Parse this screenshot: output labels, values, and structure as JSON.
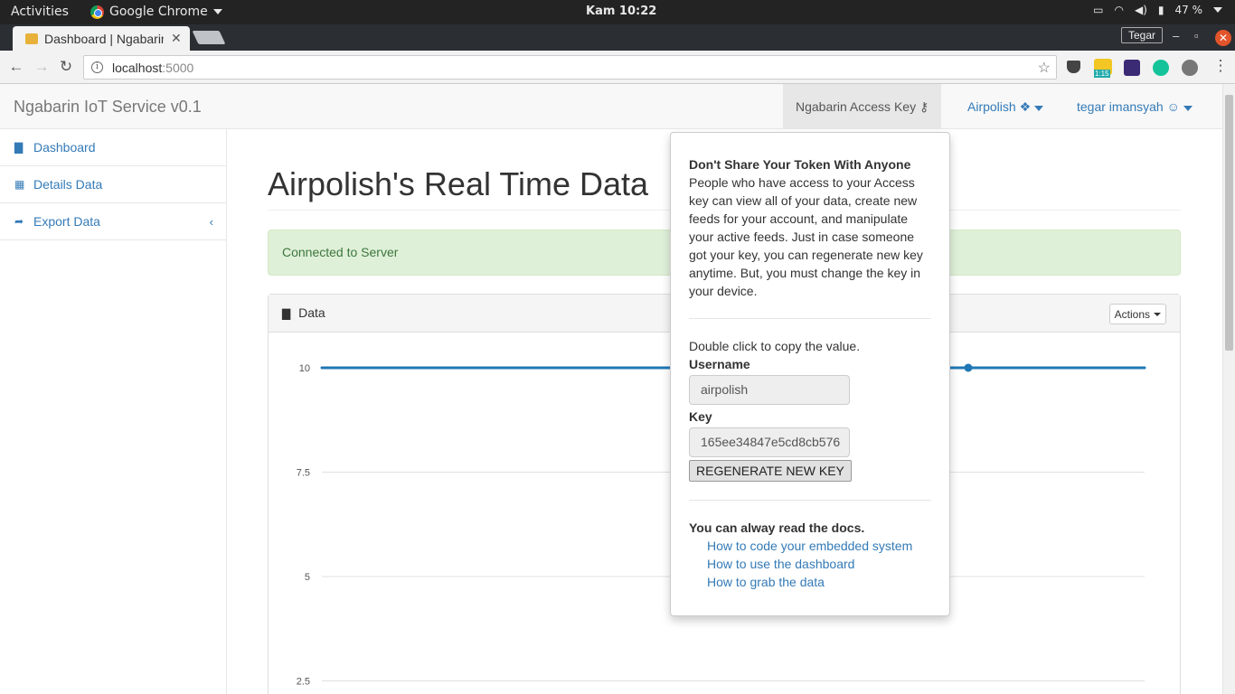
{
  "os": {
    "activities": "Activities",
    "app_menu": "Google Chrome",
    "clock": "Kam 10:22",
    "battery": "47 %"
  },
  "browser": {
    "tab_title": "Dashboard | Ngabarin",
    "profile": "Tegar",
    "url_host": "localhost",
    "url_port": ":5000",
    "extension_badge": "1:15"
  },
  "navbar": {
    "brand": "Ngabarin IoT Service v0.1",
    "access_key": "Ngabarin Access Key",
    "device": "Airpolish",
    "user": "tegar imansyah"
  },
  "sidebar": {
    "items": [
      {
        "label": "Dashboard",
        "icon": "bar-chart-icon"
      },
      {
        "label": "Details Data",
        "icon": "table-icon"
      },
      {
        "label": "Export Data",
        "icon": "share-icon"
      }
    ]
  },
  "main": {
    "title": "Airpolish's Real Time Data",
    "alert": "Connected to Server",
    "panel_title": "Data",
    "actions_label": "Actions"
  },
  "popover": {
    "warning_title": "Don't Share Your Token With Anyone",
    "warning_text": "People who have access to your Access key can view all of your data, create new feeds for your account, and manipulate your active feeds. Just in case someone got your key, you can regenerate new key anytime. But, you must change the key in your device.",
    "copy_hint": "Double click to copy the value.",
    "username_label": "Username",
    "username_value": "airpolish",
    "key_label": "Key",
    "key_value": "165ee34847e5cd8cb576",
    "regen_label": "REGENERATE NEW KEY",
    "docs_title": "You can alway read the docs.",
    "docs_links": [
      "How to code your embedded system",
      "How to use the dashboard",
      "How to grab the data"
    ]
  },
  "colors": {
    "link": "#337ab7",
    "series": "#1f77b4",
    "alert_bg": "#dff0d8"
  },
  "chart_data": {
    "type": "line",
    "y_ticks": [
      "10",
      "7.5",
      "5",
      "2.5"
    ],
    "ylim": [
      2.5,
      10
    ],
    "series": [
      {
        "values": [
          10,
          10,
          10,
          10,
          10,
          10,
          10,
          10,
          10,
          10,
          10,
          10,
          10,
          10,
          10
        ]
      }
    ],
    "highlighted_index": 11,
    "grid": true
  }
}
